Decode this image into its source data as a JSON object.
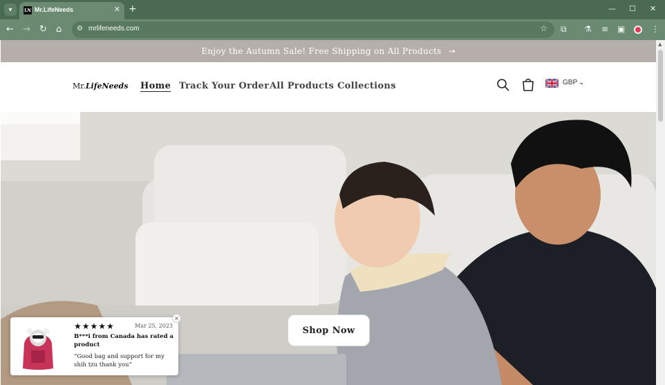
{
  "browser": {
    "tab_title": "Mr.LifeNeeds",
    "favicon_text": "LN",
    "url": "mrlifeneeds.com",
    "icons": [
      "tab-search-icon",
      "close-icon",
      "new-tab-icon",
      "minimize-icon",
      "maximize-icon",
      "window-close-icon",
      "back-icon",
      "forward-icon",
      "reload-icon",
      "home-icon",
      "site-info-icon",
      "bookmark-star-icon",
      "extensions-icon",
      "lab-icon",
      "media-icon",
      "side-panel-icon",
      "profile-icon",
      "menu-icon"
    ],
    "colors": {
      "frame": "#4a6a53",
      "toolbar": "#6a8a72"
    }
  },
  "announcement": {
    "text": "Enjoy the Autumn Sale! Free Shipping on All Products",
    "arrow": "→",
    "bg": "#b5aeab"
  },
  "header": {
    "logo_prefix": "Mr.",
    "logo_name": "LifeNeeds",
    "nav": [
      {
        "label": "Home",
        "active": true
      },
      {
        "label": "Track Your Order"
      },
      {
        "label": "All Products"
      },
      {
        "label": "Collections",
        "has_dropdown": true
      }
    ],
    "currency": "GBP"
  },
  "hero": {
    "cta_label": "Shop Now"
  },
  "review_popup": {
    "stars": 5,
    "stars_text": "★★★★★",
    "date": "Mar 25, 2023",
    "headline": "B***i from Canada has rated a product",
    "quote": "“Good bag and support for my shih tzu thank you”",
    "close": "×"
  }
}
